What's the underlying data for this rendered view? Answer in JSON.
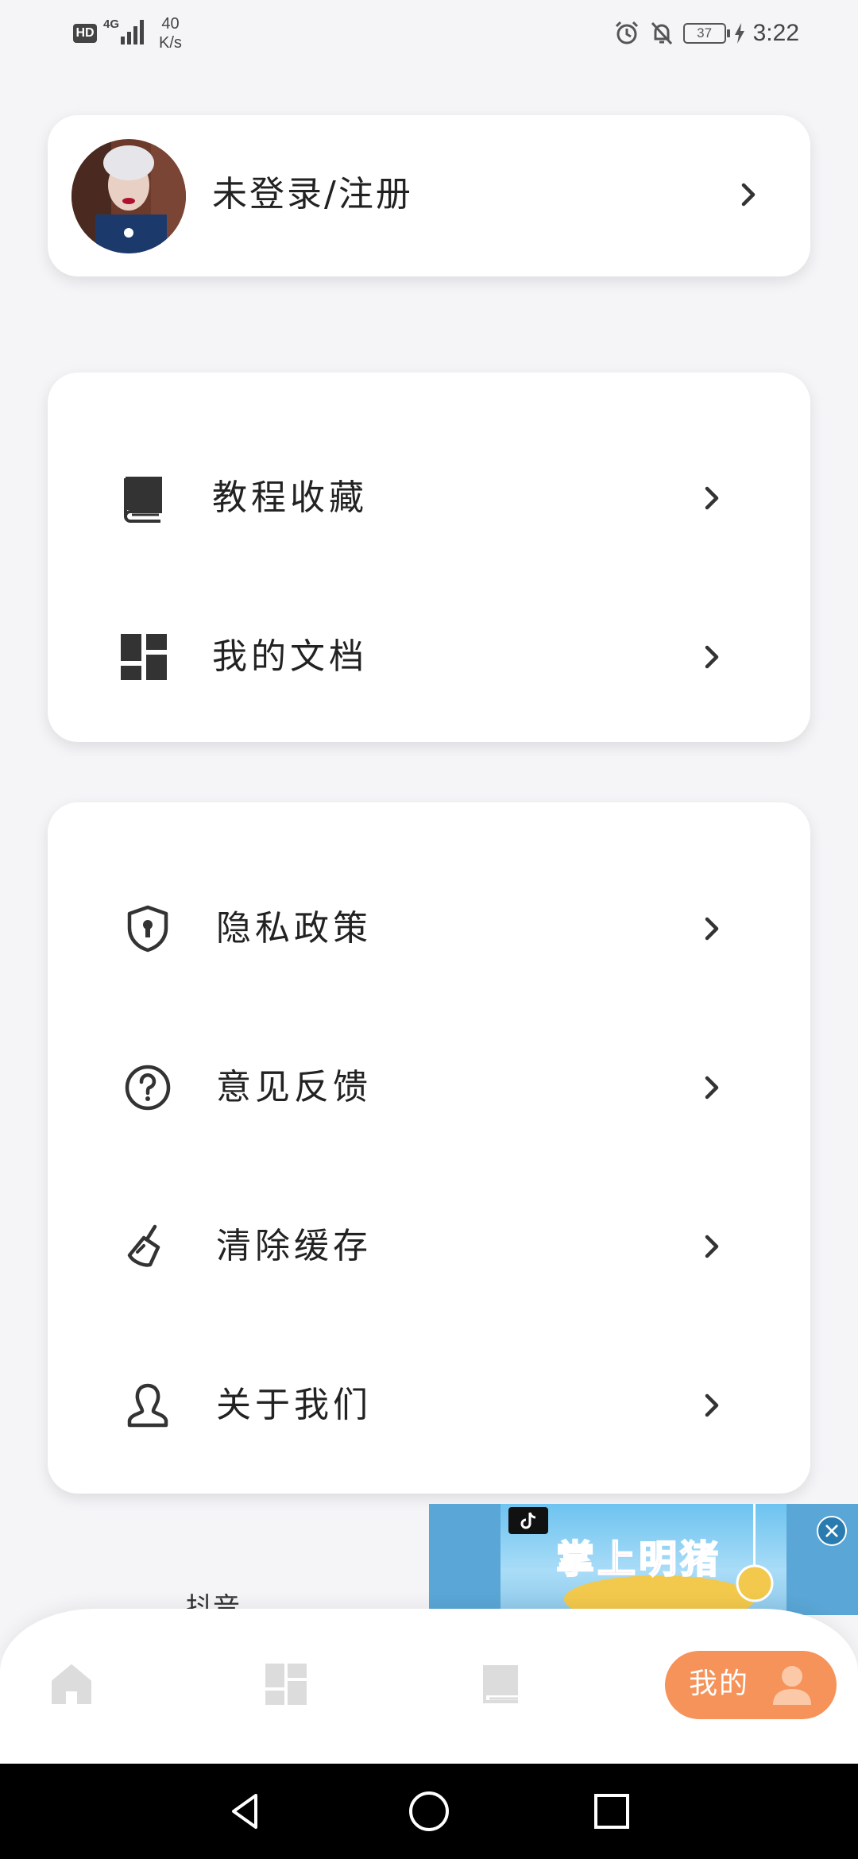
{
  "status_bar": {
    "hd": "HD",
    "network": "4G",
    "speed_value": "40",
    "speed_unit": "K/s",
    "battery": "37",
    "time": "3:22"
  },
  "profile": {
    "label": "未登录/注册",
    "avatar_icon": "user-avatar-photo"
  },
  "menu_group_1": [
    {
      "label": "教程收藏",
      "icon": "book-icon"
    },
    {
      "label": "我的文档",
      "icon": "dashboard-grid-icon"
    }
  ],
  "menu_group_2": [
    {
      "label": "隐私政策",
      "icon": "shield-icon"
    },
    {
      "label": "意见反馈",
      "icon": "question-circle-icon"
    },
    {
      "label": "清除缓存",
      "icon": "brush-icon"
    },
    {
      "label": "关于我们",
      "icon": "person-outline-icon"
    }
  ],
  "ad": {
    "source_label": "抖音",
    "banner_title": "掌上明猪"
  },
  "bottom_nav": {
    "items": [
      {
        "icon": "home-icon"
      },
      {
        "icon": "dashboard-grid-icon"
      },
      {
        "icon": "book-icon"
      }
    ],
    "active_label": "我的",
    "active_icon": "person-icon"
  },
  "colors": {
    "accent": "#f5935a",
    "background": "#f5f5f8",
    "card": "#ffffff",
    "text": "#222222",
    "inactive_icon": "#dcdcdc"
  }
}
